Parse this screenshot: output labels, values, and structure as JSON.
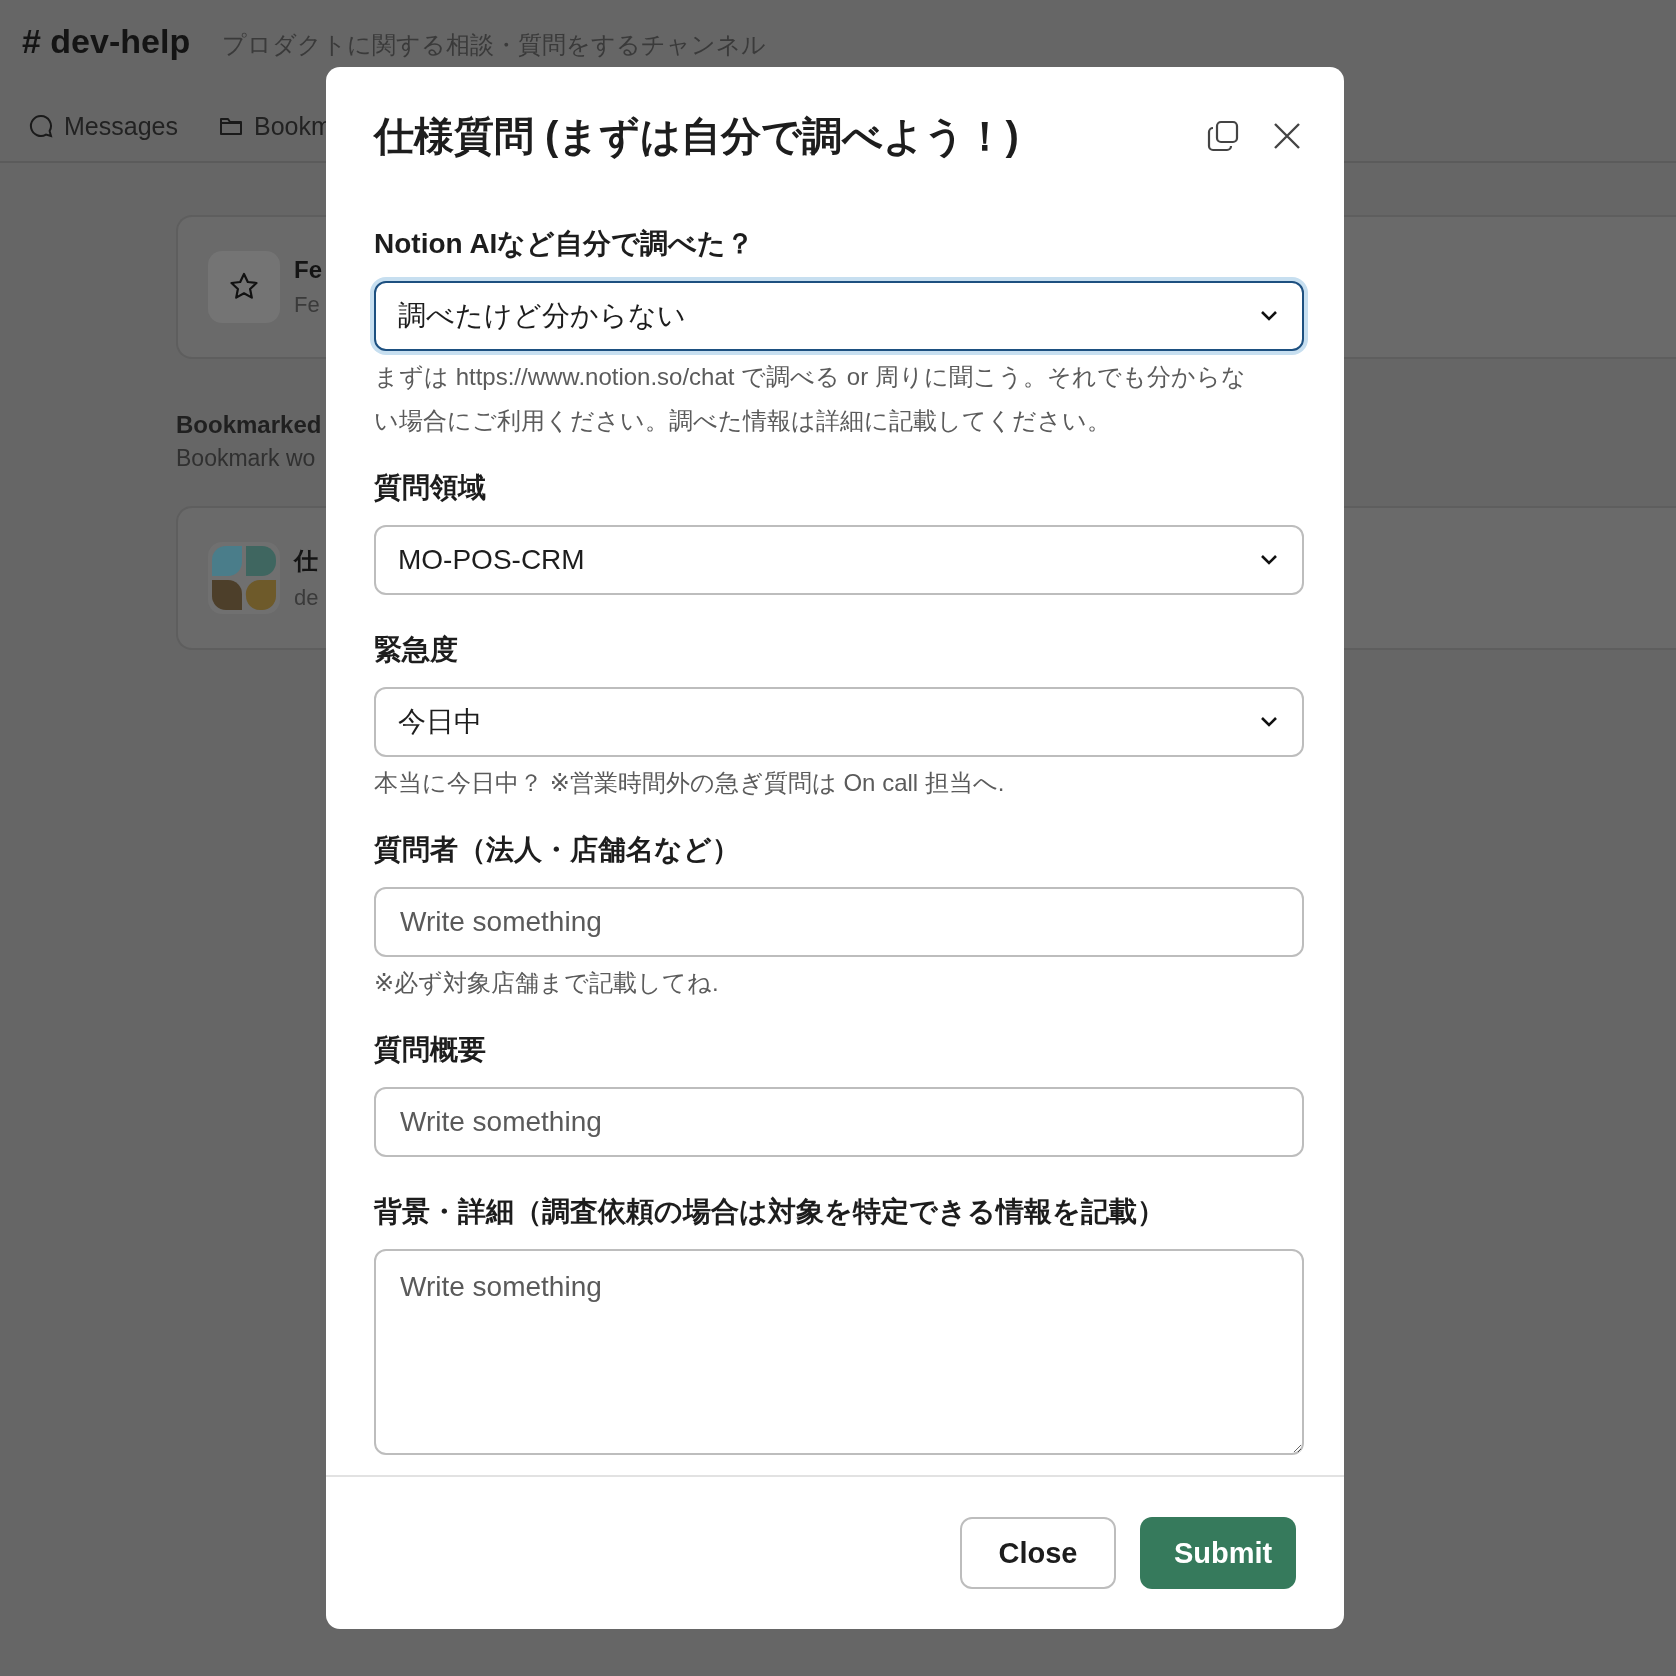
{
  "channel": {
    "hash": "#",
    "name": "dev-help",
    "topic": "プロダクトに関する相談・質問をするチャンネル"
  },
  "tabs": [
    {
      "label": "Messages",
      "kind": "messages"
    },
    {
      "label": "Bookm",
      "kind": "folder"
    }
  ],
  "content": [
    {
      "kind": "star_card",
      "title": "Fe",
      "subtitle": "Fe"
    },
    {
      "kind": "section",
      "title": "Bookmarked",
      "subtitle": "Bookmark wo"
    },
    {
      "kind": "app_card",
      "title": "仕",
      "subtitle": "de"
    }
  ],
  "modal": {
    "title": "仕様質問 (まずは自分で調べよう！)",
    "fields": [
      {
        "label": "Notion AIなど自分で調べた？",
        "kind": "select",
        "value": "調べたけど分からない",
        "focused": true,
        "help": "まずは https://www.notion.so/chat で調べる or 周りに聞こう。それでも分からない場合にご利用ください。調べた情報は詳細に記載してください。"
      },
      {
        "label": "質問領域",
        "kind": "select",
        "value": "MO-POS-CRM",
        "focused": false
      },
      {
        "label": "緊急度",
        "kind": "select",
        "value": "今日中",
        "focused": false,
        "help": "本当に今日中？ ※営業時間外の急ぎ質問は On call 担当へ."
      },
      {
        "label": "質問者（法人・店舗名など）",
        "kind": "input",
        "placeholder": "Write something",
        "help": "※必ず対象店舗まで記載してね."
      },
      {
        "label": "質問概要",
        "kind": "input",
        "placeholder": "Write something"
      },
      {
        "label": "背景・詳細（調査依頼の場合は対象を特定できる情報を記載）",
        "kind": "textarea",
        "placeholder": "Write something"
      }
    ],
    "buttons": [
      {
        "label": "Close",
        "kind": "secondary"
      },
      {
        "label": "Submit",
        "kind": "primary"
      }
    ]
  }
}
